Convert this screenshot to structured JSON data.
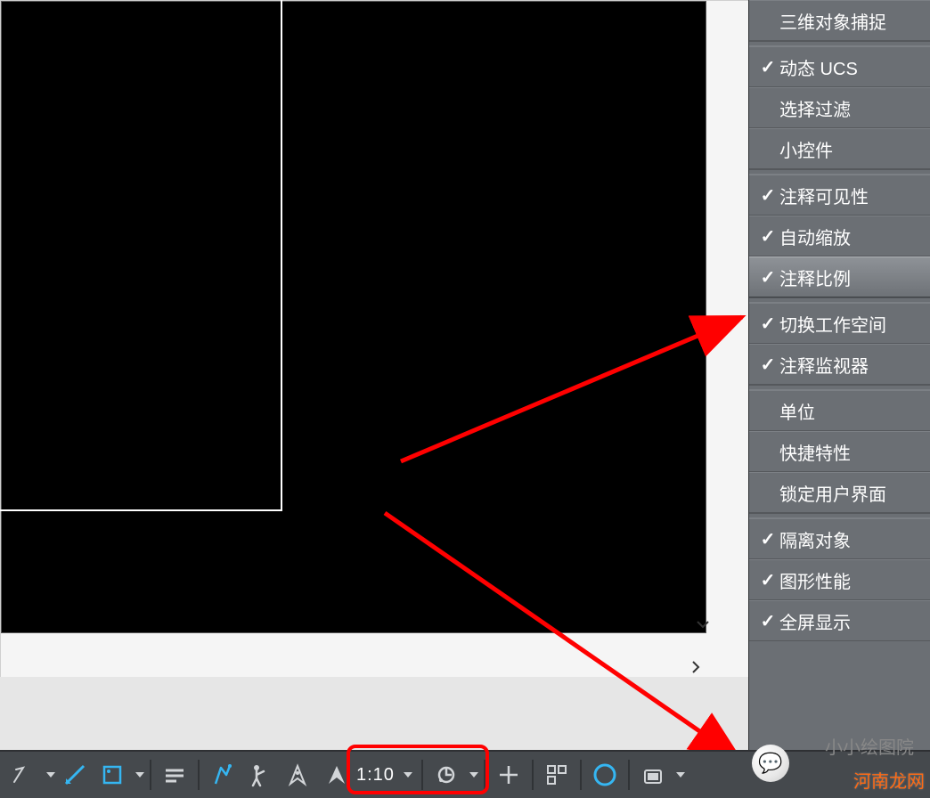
{
  "menu": {
    "items": [
      {
        "label": "三维对象捕捉",
        "checked": false
      },
      {
        "label": "动态 UCS",
        "checked": true
      },
      {
        "label": "选择过滤",
        "checked": false
      },
      {
        "label": "小控件",
        "checked": false
      },
      {
        "label": "注释可见性",
        "checked": true
      },
      {
        "label": "自动缩放",
        "checked": true
      },
      {
        "label": "注释比例",
        "checked": true,
        "highlight": true
      },
      {
        "label": "切换工作空间",
        "checked": true
      },
      {
        "label": "注释监视器",
        "checked": true
      },
      {
        "label": "单位",
        "checked": false
      },
      {
        "label": "快捷特性",
        "checked": false
      },
      {
        "label": "锁定用户界面",
        "checked": false
      },
      {
        "label": "隔离对象",
        "checked": true
      },
      {
        "label": "图形性能",
        "checked": true
      },
      {
        "label": "全屏显示",
        "checked": true
      }
    ],
    "separators_after": [
      0,
      3,
      6,
      8,
      11
    ]
  },
  "statusbar": {
    "annotation_scale": "1:10"
  },
  "overlay": {
    "side_text": "小小绘图院",
    "watermark": "河南龙网"
  }
}
